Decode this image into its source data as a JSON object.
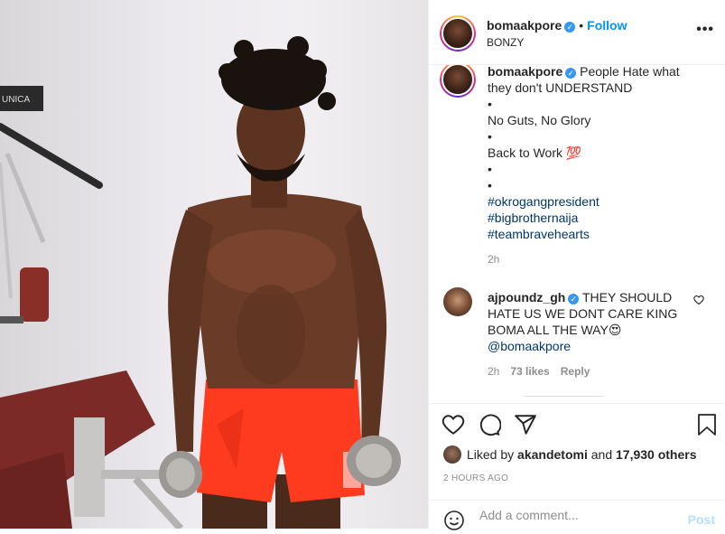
{
  "post": {
    "username": "bomaakpore",
    "verified_glyph": "✓",
    "separator": "•",
    "follow_label": "Follow",
    "location": "BONZY",
    "more_glyph": "•••"
  },
  "caption": {
    "username": "bomaakpore",
    "lines": [
      "People Hate what",
      "they don't UNDERSTAND",
      "•",
      "No Guts, No Glory",
      "•",
      "Back to Work 💯",
      "•",
      "•"
    ],
    "hashtags": [
      "#okrogangpresident",
      "#bigbrothernaija",
      "#teambravehearts"
    ],
    "time": "2h"
  },
  "comment": {
    "username": "ajpoundz_gh",
    "text": "THEY SHOULD HATE US WE DONT CARE KING BOMA ALL THE WAY😍",
    "mention": "@bomaakpore",
    "time": "2h",
    "likes": "73 likes",
    "reply_label": "Reply",
    "heart_icon": "heart-outline-icon"
  },
  "actions": {
    "liked_prefix": "Liked by ",
    "liked_user": "akandetomi",
    "liked_and": " and ",
    "liked_others": "17,930 others",
    "timestamp": "2 HOURS AGO",
    "comment_placeholder": "Add a comment...",
    "post_label": "Post"
  }
}
